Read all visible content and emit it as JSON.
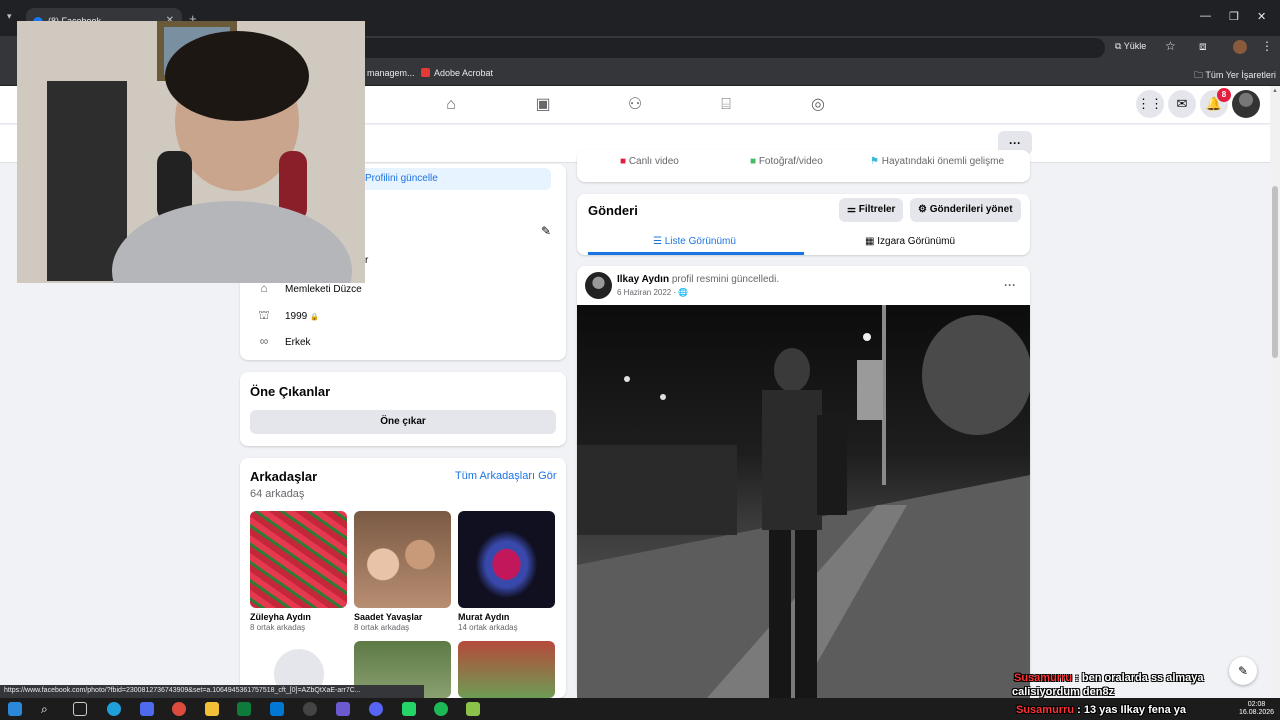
{
  "browser": {
    "tab_title": "(8) Facebook",
    "install_label": "Yükle",
    "bookmarks": [
      "managem...",
      "Adobe Acrobat"
    ],
    "all_bookmarks_label": "Tüm Yer İşaretleri",
    "status_url": "https://www.facebook.com/photo/?fbid=2300812736743909&set=a.1064945361757518_cft_[0]=AZbQtXaE-arr7C..."
  },
  "header": {
    "notification_count": "8"
  },
  "intro": {
    "update_profile_label": "Profilini güncelle",
    "partial_text": "r",
    "hometown": "Memleketi Düzce",
    "birth_year": "1999",
    "gender": "Erkek"
  },
  "highlights": {
    "title": "Öne Çıkanlar",
    "button_label": "Öne çıkar"
  },
  "friends": {
    "title": "Arkadaşlar",
    "see_all_label": "Tüm Arkadaşları Gör",
    "count_label": "64 arkadaş",
    "items": [
      {
        "name": "Züleyha Aydın",
        "mutual": "8 ortak arkadaş"
      },
      {
        "name": "Saadet Yavaşlar",
        "mutual": "8 ortak arkadaş"
      },
      {
        "name": "Murat Aydın",
        "mutual": "14 ortak arkadaş"
      }
    ]
  },
  "composer": {
    "live_video": "Canlı video",
    "photo_video": "Fotoğraf/video",
    "life_event": "Hayatındaki önemli gelişme"
  },
  "posts": {
    "title": "Gönderi",
    "filters_label": "Filtreler",
    "manage_label": "Gönderileri yönet",
    "list_view_label": "Liste Görünümü",
    "grid_view_label": "Izgara Görünümü"
  },
  "post": {
    "author": "Ilkay Aydın",
    "action": "profil resmini güncelledi.",
    "date": "6 Haziran 2022"
  },
  "chat": {
    "line1_user": "Susamurru",
    "line1_text": ": ben oralarda ss almaya",
    "line2_text": "calisiyordum den8z",
    "line3_user": "Susamurru",
    "line3_text": ": 13 yas Ilkay fena ya"
  },
  "taskbar": {
    "time": "02:08",
    "date": "16.08.2026"
  }
}
